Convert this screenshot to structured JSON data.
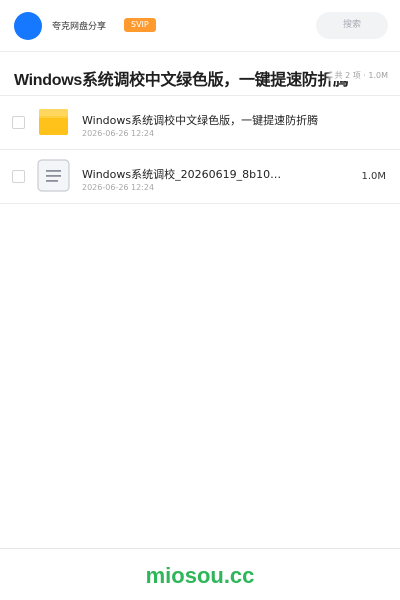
{
  "header": {
    "app_name": "夸克网盘分享",
    "badge": "SVIP",
    "search_placeholder": "搜索",
    "avatar_color": "#1677ff",
    "badge_color": "#ff9a2e"
  },
  "share": {
    "title": "Windows系统调校中文绿色版，一键提速防折腾",
    "meta": "共 2 项 · 1.0M"
  },
  "files": [
    {
      "icon": "folder-icon",
      "name": "Windows系统调校中文绿色版，一键提速防折腾",
      "date": "2026-06-26 12:24",
      "size": ""
    },
    {
      "icon": "document-icon",
      "name": "Windows系统调校_20260619_8b10…",
      "date": "2026-06-26 12:24",
      "size": "1.0M"
    }
  ],
  "footer": {
    "brand": "miosou.cc",
    "brand_color": "#2fb65a"
  }
}
